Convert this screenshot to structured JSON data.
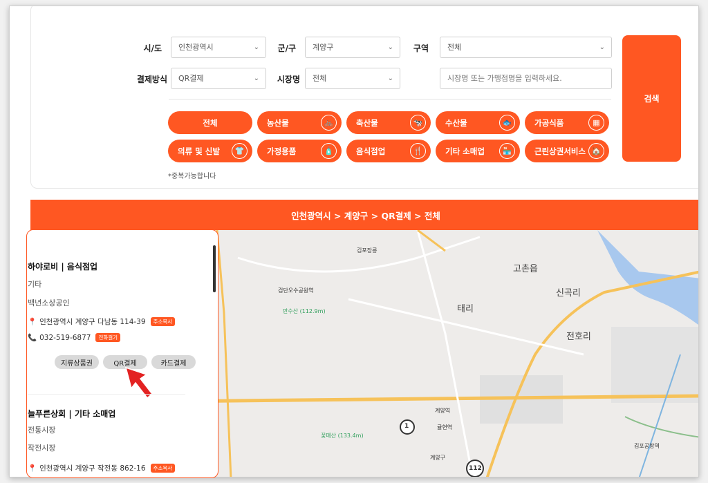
{
  "filters": {
    "sido_label": "시/도",
    "sido_value": "인천광역시",
    "gungu_label": "군/구",
    "gungu_value": "계양구",
    "area_label": "구역",
    "area_value": "전체",
    "pay_label": "결제방식",
    "pay_value": "QR결제",
    "market_label": "시장명",
    "market_value": "전체",
    "search_placeholder": "시장명 또는 가맹점명을 입력하세요.",
    "search_button": "검색",
    "chevron": "⌄"
  },
  "categories": [
    {
      "label": "전체",
      "icon": ""
    },
    {
      "label": "농산물",
      "icon": "🚲"
    },
    {
      "label": "축산물",
      "icon": "🐄"
    },
    {
      "label": "수산물",
      "icon": "🐟"
    },
    {
      "label": "가공식품",
      "icon": "▦"
    },
    {
      "label": "의류 및 신발",
      "icon": "👕"
    },
    {
      "label": "가정용품",
      "icon": "🧴"
    },
    {
      "label": "음식점업",
      "icon": "🍴"
    },
    {
      "label": "기타 소매업",
      "icon": "🏪"
    },
    {
      "label": "근린상권서비스",
      "icon": "🏠"
    }
  ],
  "note": "*중복가능합니다",
  "breadcrumb": "인천광역시 > 계양구 > QR결제 > 전체",
  "stores": [
    {
      "name": "하야로비 | 음식점업",
      "type": "기타",
      "market": "백년소상공인",
      "address": "인천광역시 계양구 다남동 114-39",
      "address_tag": "주소복사",
      "phone": "032-519-6877",
      "phone_tag": "전화걸기"
    },
    {
      "name": "늘푸른상회 | 기타 소매업",
      "type": "전통시장",
      "market": "작전시장",
      "address": "인천광역시 계양구 작전동 862-16",
      "address_tag": "주소복사"
    }
  ],
  "pay_buttons": [
    "지류상품권",
    "QR결제",
    "카드결제"
  ],
  "map_labels": {
    "gochon": "고촌읍",
    "singokri": "신곡리",
    "taeri": "태리",
    "jeonhori": "전호리",
    "gyeyanggu": "계양구",
    "gimpo_airport": "김포공항역",
    "gimpo_jangreung": "김포장릉",
    "geomdan": "검단오수공원역",
    "misu": "만수산\n(112.9m)",
    "kkotmae": "꽃매산\n(133.4m)",
    "gyeyang_st": "계양역",
    "gulhyeon": "귤현역",
    "marker_1": "1",
    "marker_112": "112"
  }
}
